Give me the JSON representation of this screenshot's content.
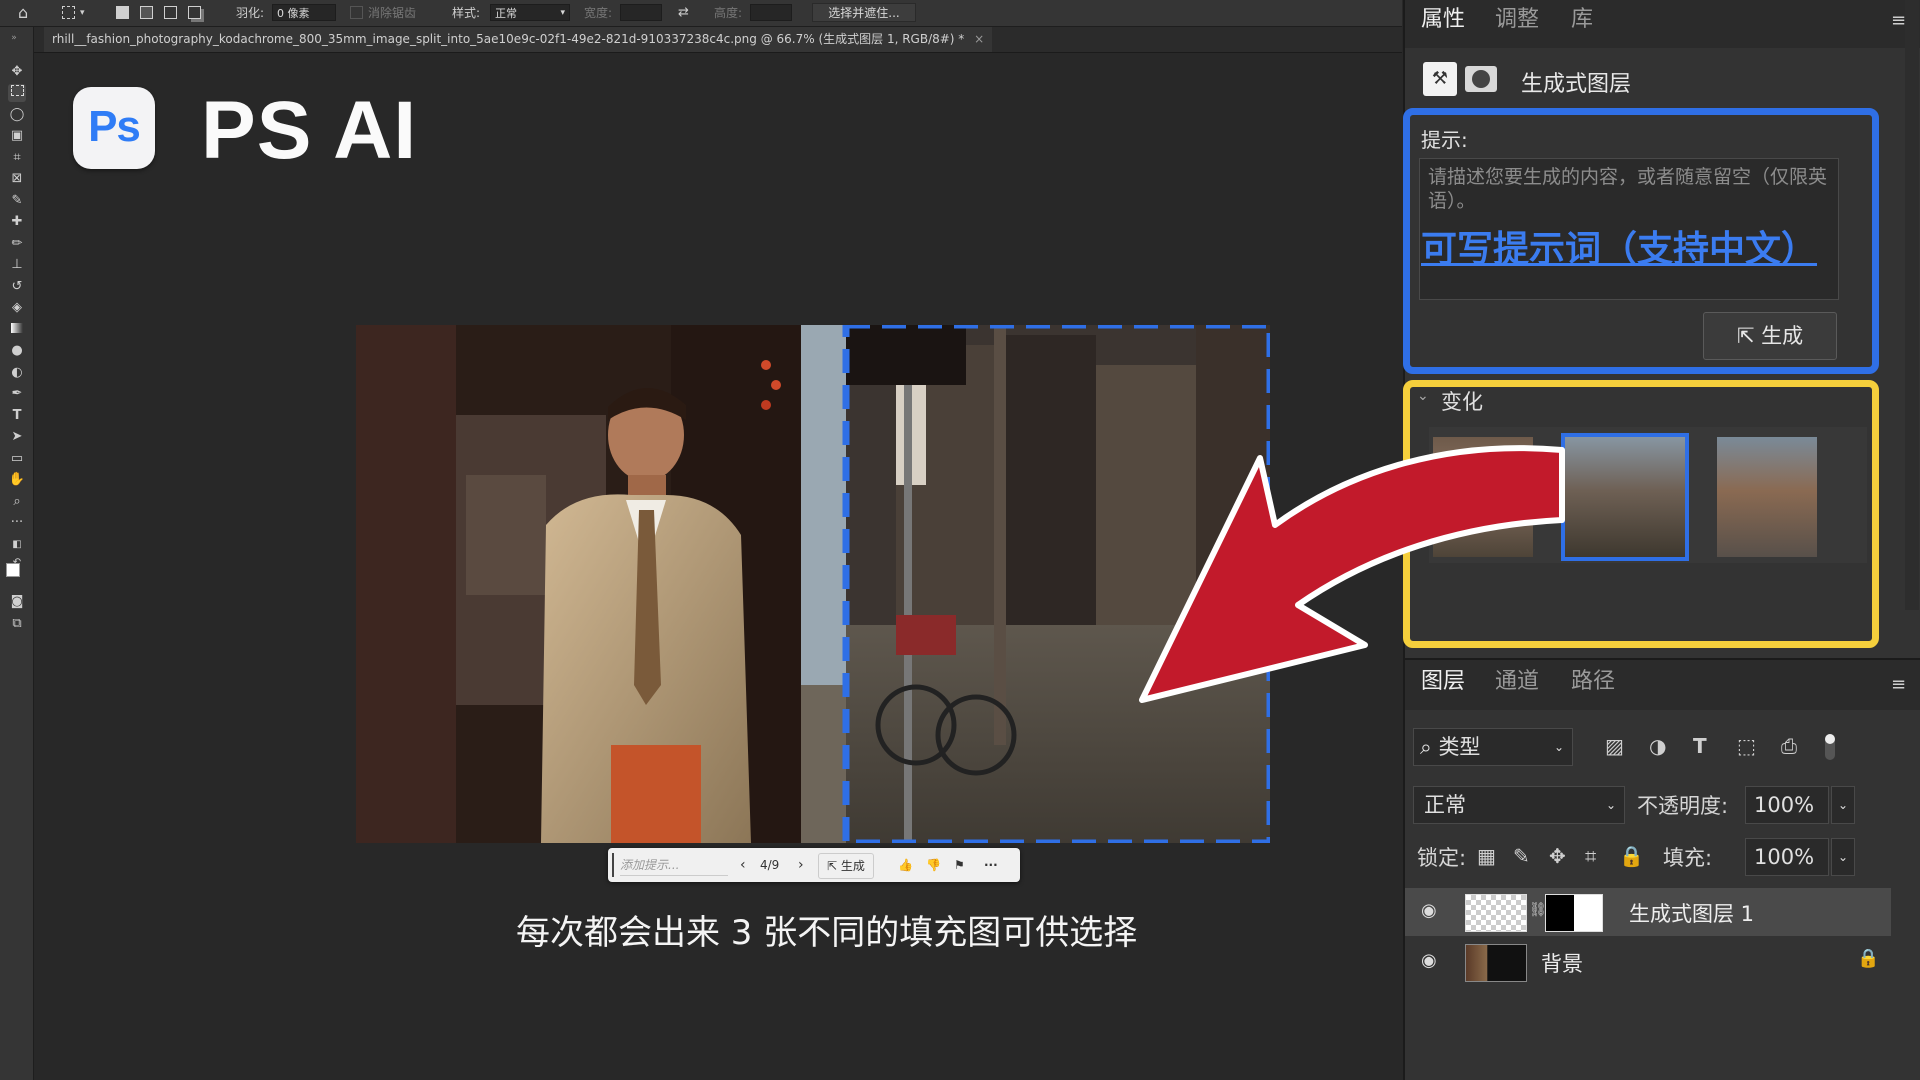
{
  "options_bar": {
    "feather_label": "羽化:",
    "feather_value": "0 像素",
    "antialias_label": "消除锯齿",
    "style_label": "样式:",
    "style_value": "正常",
    "width_label": "宽度:",
    "height_label": "高度:",
    "select_mask_button": "选择并遮住..."
  },
  "document_tab": {
    "title": "rhill__fashion_photography_kodachrome_800_35mm_image_split_into_5ae10e9c-02f1-49e2-821d-910337238c4c.png @ 66.7% (生成式图层 1, RGB/8#) *",
    "close": "×"
  },
  "branding": {
    "logo_text": "Ps",
    "title": "PS AI"
  },
  "canvas_taskbar": {
    "prompt_placeholder": "添加提示...",
    "page_indicator": "4/9",
    "generate_label": "生成",
    "more": "···"
  },
  "caption": "每次都会出来 3 张不同的填充图可供选择",
  "properties_panel": {
    "tabs": [
      "属性",
      "调整",
      "库"
    ],
    "active_tab": "属性",
    "layer_type_label": "生成式图层",
    "prompt_label": "提示:",
    "prompt_placeholder": "请描述您要生成的内容，或者随意留空（仅限英语）。",
    "prompt_annotation": "可写提示词（支持中文）",
    "generate_button": "生成",
    "variations_label": "变化",
    "variations_count": 3,
    "selected_variation": 2
  },
  "layers_panel": {
    "tabs": [
      "图层",
      "通道",
      "路径"
    ],
    "active_tab": "图层",
    "filter_kind": "类型",
    "blend_mode": "正常",
    "opacity_label": "不透明度:",
    "opacity_value": "100%",
    "lock_label": "锁定:",
    "fill_label": "填充:",
    "fill_value": "100%",
    "layers": [
      {
        "name": "生成式图层 1",
        "visible": true,
        "selected": true
      },
      {
        "name": "背景",
        "visible": true,
        "locked": true
      }
    ]
  },
  "colors": {
    "highlight_blue": "#2f6fe6",
    "highlight_yellow": "#f5cf3c",
    "arrow_red": "#c21a2b",
    "ps_blue": "#2f7cf6"
  }
}
